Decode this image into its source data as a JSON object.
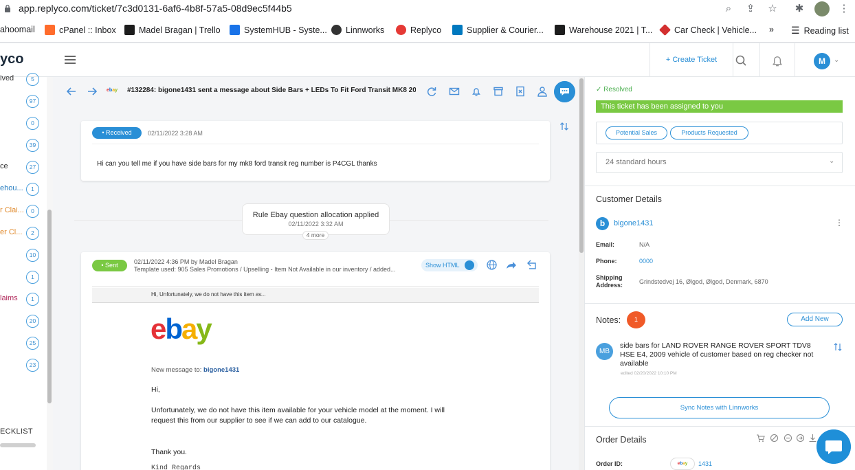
{
  "browser": {
    "url": "app.replyco.com/ticket/7c3d0131-6af6-4b8f-57a5-08d9ec5f44b5",
    "bookmarks": [
      {
        "label": "ahoomail",
        "color": "#6001d2"
      },
      {
        "label": "cPanel :: Inbox",
        "color": "#ff6c2c"
      },
      {
        "label": "Madel Bragan | Trello",
        "color": "#1d1d1d"
      },
      {
        "label": "SystemHUB - Syste...",
        "color": "#1a73e8"
      },
      {
        "label": "Linnworks",
        "color": "#333333"
      },
      {
        "label": "Replyco",
        "color": "#e53935"
      },
      {
        "label": "Supplier & Courier...",
        "color": "#0079bf"
      },
      {
        "label": "Warehouse 2021 | T...",
        "color": "#1d1d1d"
      },
      {
        "label": "Car Check | Vehicle...",
        "color": "#d32f2f"
      }
    ],
    "bookmarks_more": "»",
    "reading_list": "Reading list"
  },
  "header": {
    "logo": "yco",
    "create_ticket": "+ Create Ticket",
    "avatar_initial": "M"
  },
  "sidebar": {
    "items": [
      {
        "label": "ived",
        "count": "5",
        "color": "#333333"
      },
      {
        "label": "",
        "count": "97",
        "color": "#333333"
      },
      {
        "label": "",
        "count": "0",
        "color": "#333333"
      },
      {
        "label": "",
        "count": "39",
        "color": "#333333"
      },
      {
        "label": "ce",
        "count": "27",
        "color": "#333333"
      },
      {
        "label": "ehou...",
        "count": "1",
        "color": "#2a7fc0"
      },
      {
        "label": "r Clai...",
        "count": "0",
        "color": "#e0892b"
      },
      {
        "label": "er Cl...",
        "count": "2",
        "color": "#e0892b"
      },
      {
        "label": "",
        "count": "10",
        "color": "#333333"
      },
      {
        "label": "",
        "count": "1",
        "color": "#333333"
      },
      {
        "label": "laims",
        "count": "1",
        "color": "#b0285a"
      },
      {
        "label": "",
        "count": "20",
        "color": "#333333"
      },
      {
        "label": "",
        "count": "25",
        "color": "#333333"
      },
      {
        "label": "",
        "count": "23",
        "color": "#333333"
      }
    ],
    "checklist": "ECKLIST"
  },
  "ticket": {
    "subject": "#132284: bigone1431 sent a message about Side Bars + LEDs To Fit Ford Transit MK8 20...",
    "channel": "ebay"
  },
  "messages": {
    "received": {
      "badge": "• Received",
      "date": "02/11/2022 3:28 AM",
      "body": "Hi can you tell me if you have side bars for my mk8 ford transit reg number is P4CGL thanks"
    },
    "rule": {
      "title": "Rule Ebay question allocation applied",
      "date": "02/11/2022 3:32 AM",
      "more": "4 more"
    },
    "sent": {
      "badge": "• Sent",
      "meta": "02/11/2022 4:36 PM   by Madel Bragan",
      "template": "Template used: 905 Sales Promotions / Upselling - Item Not Available in our inventory / added...",
      "show_html": "Show HTML",
      "preheader": "Hi,   Unfortunately, we do not have this item av...",
      "new_message_prefix": "New message to:",
      "new_message_to": "bigone1431",
      "greeting": "Hi,",
      "para1_line1": "Unfortunately, we do not have this item available for your vehicle model at the moment. I will",
      "para1_line2": "request this from our supplier to see if we can add to our catalogue.",
      "thanks": "Thank you.",
      "kind": "Kind Regards"
    }
  },
  "right": {
    "status": "Resolved",
    "assigned": "This ticket has been assigned to you",
    "tags": [
      "Potential Sales",
      "Products Requested"
    ],
    "sla": "24 standard hours",
    "customer": {
      "title": "Customer Details",
      "initial": "b",
      "name": "bigone1431",
      "email_label": "Email:",
      "email": "N/A",
      "phone_label": "Phone:",
      "phone": "0000",
      "shipping_label_1": "Shipping",
      "shipping_label_2": "Address:",
      "shipping": "Grindstedvej 16, Ølgod, Ølgod, Denmark, 6870"
    },
    "notes": {
      "title": "Notes:",
      "count": "1",
      "add_new": "Add New",
      "avatar": "MB",
      "text": "side bars for LAND ROVER RANGE ROVER SPORT TDV8 HSE E4, 2009 vehicle of customer based on reg checker not available",
      "edited": "edited 02/20/2022 10:10 PM",
      "sync": "Sync Notes with Linnworks"
    },
    "order": {
      "title": "Order Details",
      "id_label": "Order ID:",
      "channel": "ebay",
      "id": "1431"
    }
  }
}
